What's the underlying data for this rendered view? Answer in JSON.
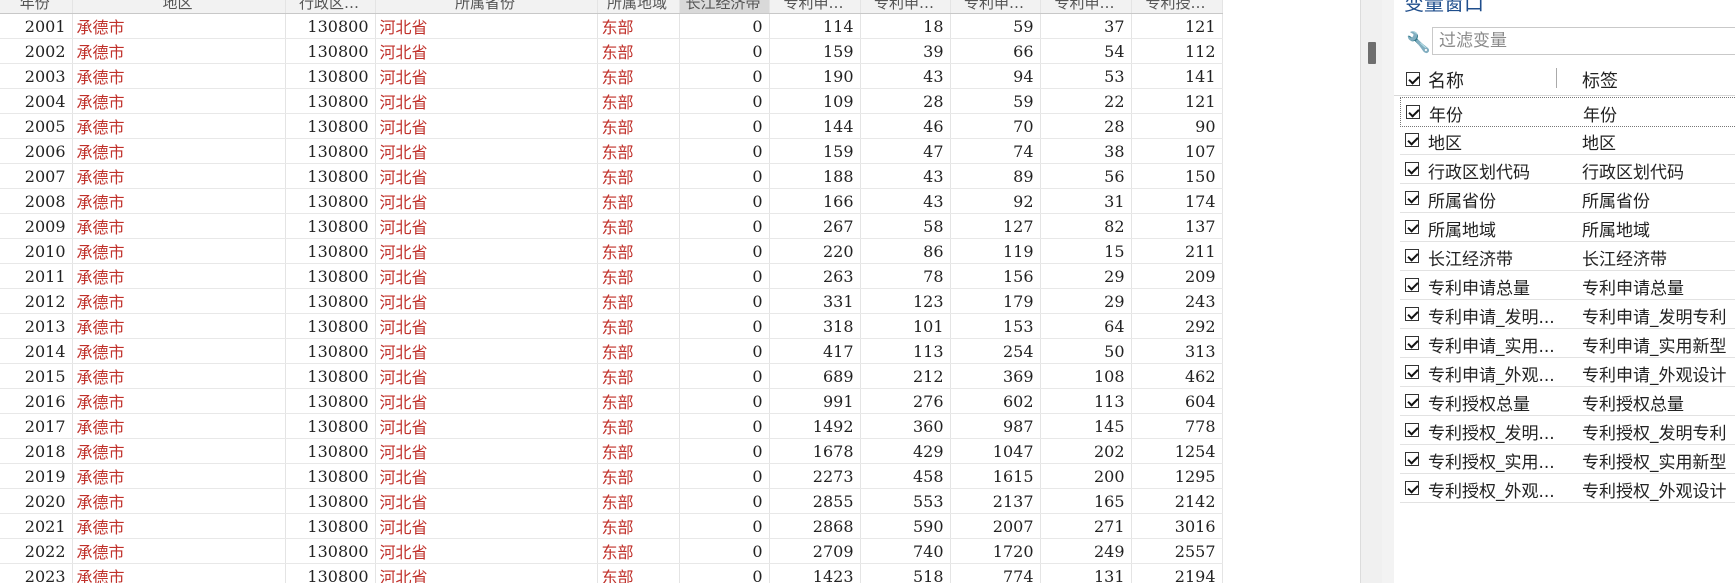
{
  "grid": {
    "headers": [
      "年份",
      "地区",
      "行政区…",
      "所属省份",
      "所属地域",
      "长江经济带",
      "专利申…",
      "专利申…",
      "专利申…",
      "专利申…",
      "专利授…"
    ],
    "rows": [
      [
        "2001",
        "承德市",
        "130800",
        "河北省",
        "东部",
        "0",
        "114",
        "18",
        "59",
        "37",
        "121"
      ],
      [
        "2002",
        "承德市",
        "130800",
        "河北省",
        "东部",
        "0",
        "159",
        "39",
        "66",
        "54",
        "112"
      ],
      [
        "2003",
        "承德市",
        "130800",
        "河北省",
        "东部",
        "0",
        "190",
        "43",
        "94",
        "53",
        "141"
      ],
      [
        "2004",
        "承德市",
        "130800",
        "河北省",
        "东部",
        "0",
        "109",
        "28",
        "59",
        "22",
        "121"
      ],
      [
        "2005",
        "承德市",
        "130800",
        "河北省",
        "东部",
        "0",
        "144",
        "46",
        "70",
        "28",
        "90"
      ],
      [
        "2006",
        "承德市",
        "130800",
        "河北省",
        "东部",
        "0",
        "159",
        "47",
        "74",
        "38",
        "107"
      ],
      [
        "2007",
        "承德市",
        "130800",
        "河北省",
        "东部",
        "0",
        "188",
        "43",
        "89",
        "56",
        "150"
      ],
      [
        "2008",
        "承德市",
        "130800",
        "河北省",
        "东部",
        "0",
        "166",
        "43",
        "92",
        "31",
        "174"
      ],
      [
        "2009",
        "承德市",
        "130800",
        "河北省",
        "东部",
        "0",
        "267",
        "58",
        "127",
        "82",
        "137"
      ],
      [
        "2010",
        "承德市",
        "130800",
        "河北省",
        "东部",
        "0",
        "220",
        "86",
        "119",
        "15",
        "211"
      ],
      [
        "2011",
        "承德市",
        "130800",
        "河北省",
        "东部",
        "0",
        "263",
        "78",
        "156",
        "29",
        "209"
      ],
      [
        "2012",
        "承德市",
        "130800",
        "河北省",
        "东部",
        "0",
        "331",
        "123",
        "179",
        "29",
        "243"
      ],
      [
        "2013",
        "承德市",
        "130800",
        "河北省",
        "东部",
        "0",
        "318",
        "101",
        "153",
        "64",
        "292"
      ],
      [
        "2014",
        "承德市",
        "130800",
        "河北省",
        "东部",
        "0",
        "417",
        "113",
        "254",
        "50",
        "313"
      ],
      [
        "2015",
        "承德市",
        "130800",
        "河北省",
        "东部",
        "0",
        "689",
        "212",
        "369",
        "108",
        "462"
      ],
      [
        "2016",
        "承德市",
        "130800",
        "河北省",
        "东部",
        "0",
        "991",
        "276",
        "602",
        "113",
        "604"
      ],
      [
        "2017",
        "承德市",
        "130800",
        "河北省",
        "东部",
        "0",
        "1492",
        "360",
        "987",
        "145",
        "778"
      ],
      [
        "2018",
        "承德市",
        "130800",
        "河北省",
        "东部",
        "0",
        "1678",
        "429",
        "1047",
        "202",
        "1254"
      ],
      [
        "2019",
        "承德市",
        "130800",
        "河北省",
        "东部",
        "0",
        "2273",
        "458",
        "1615",
        "200",
        "1295"
      ],
      [
        "2020",
        "承德市",
        "130800",
        "河北省",
        "东部",
        "0",
        "2855",
        "553",
        "2137",
        "165",
        "2142"
      ],
      [
        "2021",
        "承德市",
        "130800",
        "河北省",
        "东部",
        "0",
        "2868",
        "590",
        "2007",
        "271",
        "3016"
      ],
      [
        "2022",
        "承德市",
        "130800",
        "河北省",
        "东部",
        "0",
        "2709",
        "740",
        "1720",
        "249",
        "2557"
      ],
      [
        "2023",
        "承德市",
        "130800",
        "河北省",
        "东部",
        "0",
        "1423",
        "518",
        "774",
        "131",
        "2194"
      ]
    ]
  },
  "variables_panel": {
    "title": "变量窗口",
    "filter_placeholder": "过滤变量",
    "header_name": "名称",
    "header_label": "标签",
    "variables": [
      {
        "name": "年份",
        "label": "年份"
      },
      {
        "name": "地区",
        "label": "地区"
      },
      {
        "name": "行政区划代码",
        "label": "行政区划代码"
      },
      {
        "name": "所属省份",
        "label": "所属省份"
      },
      {
        "name": "所属地域",
        "label": "所属地域"
      },
      {
        "name": "长江经济带",
        "label": "长江经济带"
      },
      {
        "name": "专利申请总量",
        "label": "专利申请总量"
      },
      {
        "name": "专利申请_发明...",
        "label": "专利申请_发明专利"
      },
      {
        "name": "专利申请_实用...",
        "label": "专利申请_实用新型"
      },
      {
        "name": "专利申请_外观...",
        "label": "专利申请_外观设计"
      },
      {
        "name": "专利授权总量",
        "label": "专利授权总量"
      },
      {
        "name": "专利授权_发明...",
        "label": "专利授权_发明专利"
      },
      {
        "name": "专利授权_实用...",
        "label": "专利授权_实用新型"
      },
      {
        "name": "专利授权_外观...",
        "label": "专利授权_外观设计"
      }
    ]
  },
  "colors": {
    "string_cell": "#c0302a",
    "numeric_cell": "#222222",
    "panel_title": "#1f4e8c"
  },
  "icons": {
    "filter": "wrench-icon"
  }
}
